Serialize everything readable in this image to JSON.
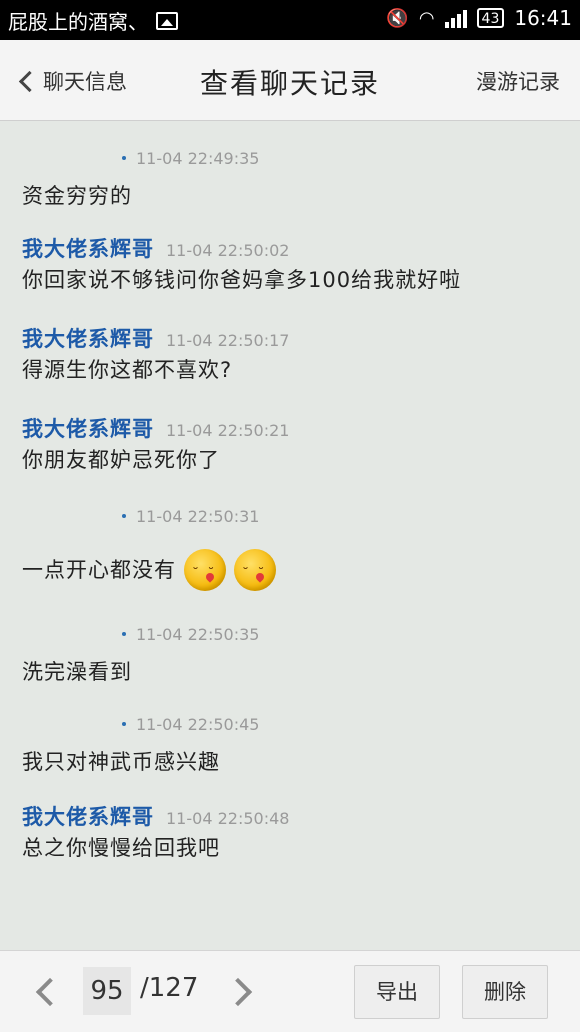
{
  "status_bar": {
    "notification_text": "屁股上的酒窝、",
    "battery": "43",
    "time": "16:41"
  },
  "header": {
    "back_label": "聊天信息",
    "title": "查看聊天记录",
    "roam_label": "漫游记录"
  },
  "messages": [
    {
      "sender": "",
      "time": "11-04 22:49:35",
      "text": "资金穷穷的",
      "emoji_count": 0
    },
    {
      "sender": "我大佬系辉哥",
      "time": "11-04 22:50:02",
      "text": "你回家说不够钱问你爸妈拿多100给我就好啦",
      "emoji_count": 0
    },
    {
      "sender": "我大佬系辉哥",
      "time": "11-04 22:50:17",
      "text": "得源生你这都不喜欢?",
      "emoji_count": 0
    },
    {
      "sender": "我大佬系辉哥",
      "time": "11-04 22:50:21",
      "text": "你朋友都妒忌死你了",
      "emoji_count": 0
    },
    {
      "sender": "",
      "time": "11-04 22:50:31",
      "text": "一点开心都没有",
      "emoji_count": 2
    },
    {
      "sender": "",
      "time": "11-04 22:50:35",
      "text": "洗完澡看到",
      "emoji_count": 0
    },
    {
      "sender": "",
      "time": "11-04 22:50:45",
      "text": "我只对神武币感兴趣",
      "emoji_count": 0
    },
    {
      "sender": "我大佬系辉哥",
      "time": "11-04 22:50:48",
      "text": "总之你慢慢给回我吧",
      "emoji_count": 0
    }
  ],
  "footer": {
    "current_page": "95",
    "total_pages": "/127",
    "export_label": "导出",
    "delete_label": "删除"
  },
  "colors": {
    "sender": "#1d5aa8",
    "background": "#e4e8e4",
    "timestamp": "#9a9a9a"
  }
}
